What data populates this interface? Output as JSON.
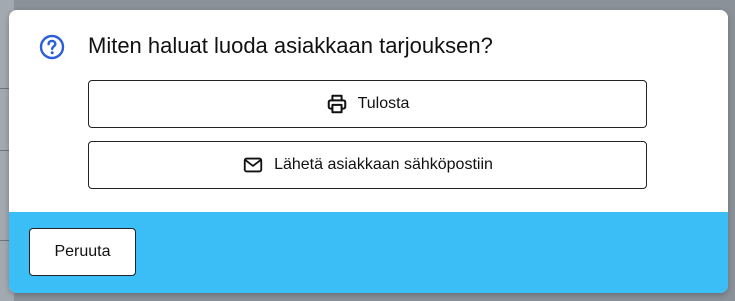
{
  "dialog": {
    "title": "Miten haluat luoda asiakkaan tarjouksen?",
    "title_icon": "question-circle-icon",
    "accent_color": "#2b5fd9",
    "footer_color": "#3bbdf6",
    "options": [
      {
        "label": "Tulosta",
        "icon": "printer-icon"
      },
      {
        "label": "Lähetä asiakkaan sähköpostiin",
        "icon": "mail-icon"
      }
    ],
    "cancel_label": "Peruuta"
  }
}
